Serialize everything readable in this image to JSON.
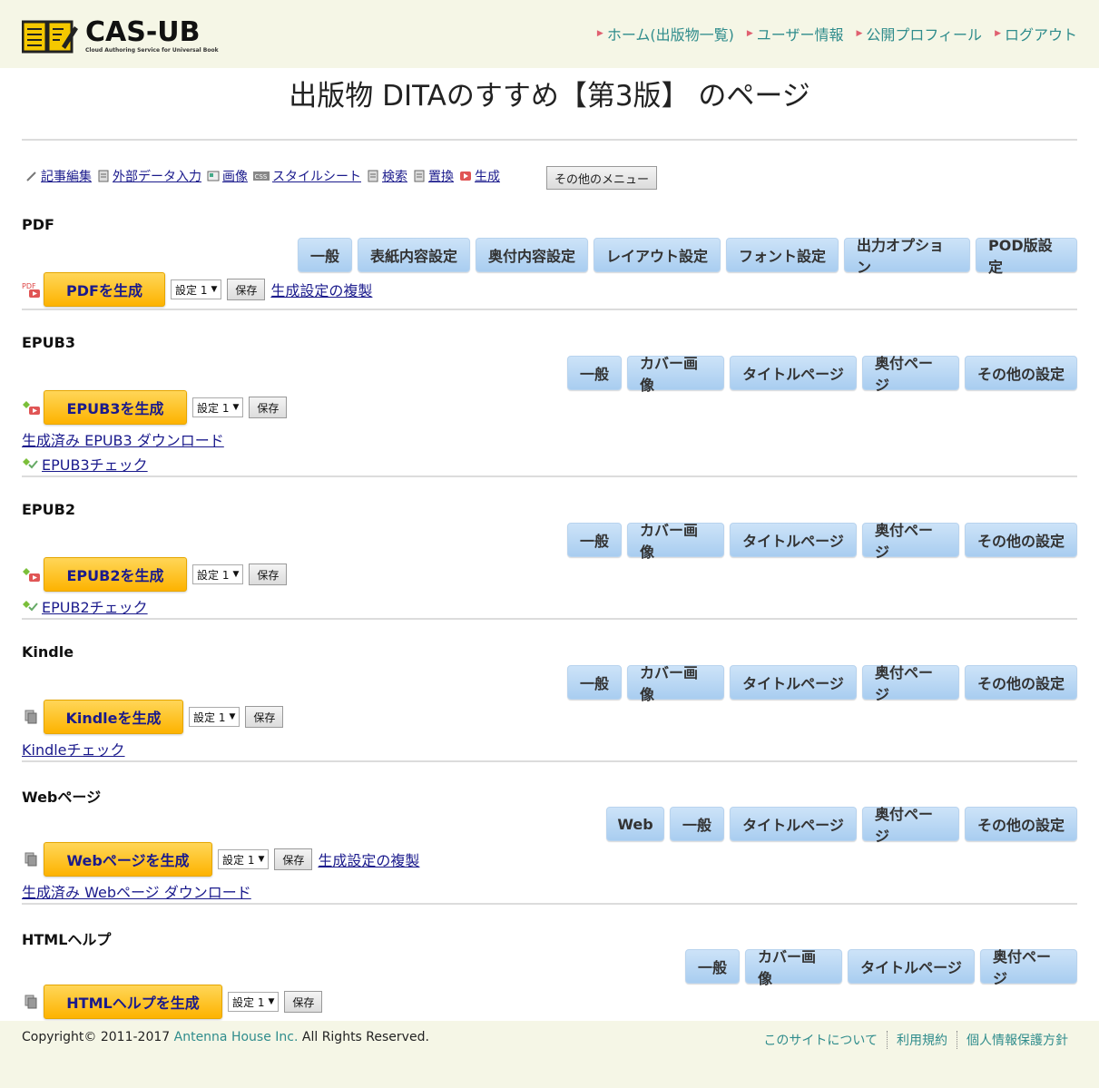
{
  "header": {
    "logo_text": "CAS-UB",
    "logo_sub": "Cloud Authoring Service for Universal Book",
    "nav": [
      "ホーム(出版物一覧)",
      "ユーザー情報",
      "公開プロフィール",
      "ログアウト"
    ]
  },
  "page_title": "出版物 DITAのすすめ【第3版】 のページ",
  "menu": {
    "items": [
      "記事編集",
      "外部データ入力",
      "画像",
      "スタイルシート",
      "検索",
      "置換",
      "生成"
    ],
    "other": "その他のメニュー"
  },
  "common": {
    "setting": "設定 1",
    "save": "保存",
    "copy": "生成設定の複製"
  },
  "sections": {
    "pdf": {
      "title": "PDF",
      "tabs": [
        "一般",
        "表紙内容設定",
        "奥付内容設定",
        "レイアウト設定",
        "フォント設定",
        "出力オプション",
        "POD版設定"
      ],
      "generate": "PDFを生成"
    },
    "epub3": {
      "title": "EPUB3",
      "tabs": [
        "一般",
        "カバー画像",
        "タイトルページ",
        "奥付ページ",
        "その他の設定"
      ],
      "generate": "EPUB3を生成",
      "download": "生成済み EPUB3 ダウンロード",
      "check": "EPUB3チェック"
    },
    "epub2": {
      "title": "EPUB2",
      "tabs": [
        "一般",
        "カバー画像",
        "タイトルページ",
        "奥付ページ",
        "その他の設定"
      ],
      "generate": "EPUB2を生成",
      "check": "EPUB2チェック"
    },
    "kindle": {
      "title": "Kindle",
      "tabs": [
        "一般",
        "カバー画像",
        "タイトルページ",
        "奥付ページ",
        "その他の設定"
      ],
      "generate": "Kindleを生成",
      "check": "Kindleチェック"
    },
    "web": {
      "title": "Webページ",
      "tabs": [
        "Web",
        "一般",
        "タイトルページ",
        "奥付ページ",
        "その他の設定"
      ],
      "generate": "Webページを生成",
      "download": "生成済み Webページ ダウンロード"
    },
    "htmlhelp": {
      "title": "HTMLヘルプ",
      "tabs": [
        "一般",
        "カバー画像",
        "タイトルページ",
        "奥付ページ"
      ],
      "generate": "HTMLヘルプを生成"
    }
  },
  "footer": {
    "copyright_pre": "Copyright© 2011-2017 ",
    "company": "Antenna House Inc.",
    "copyright_post": " All Rights Reserved.",
    "links": [
      "このサイトについて",
      "利用規約",
      "個人情報保護方針"
    ]
  },
  "colors": {
    "header_bg": "#f5f6e6",
    "tab_blue": "#a9cdf0",
    "gen_orange": "#fdb300",
    "link_teal": "#2f8c8c"
  }
}
